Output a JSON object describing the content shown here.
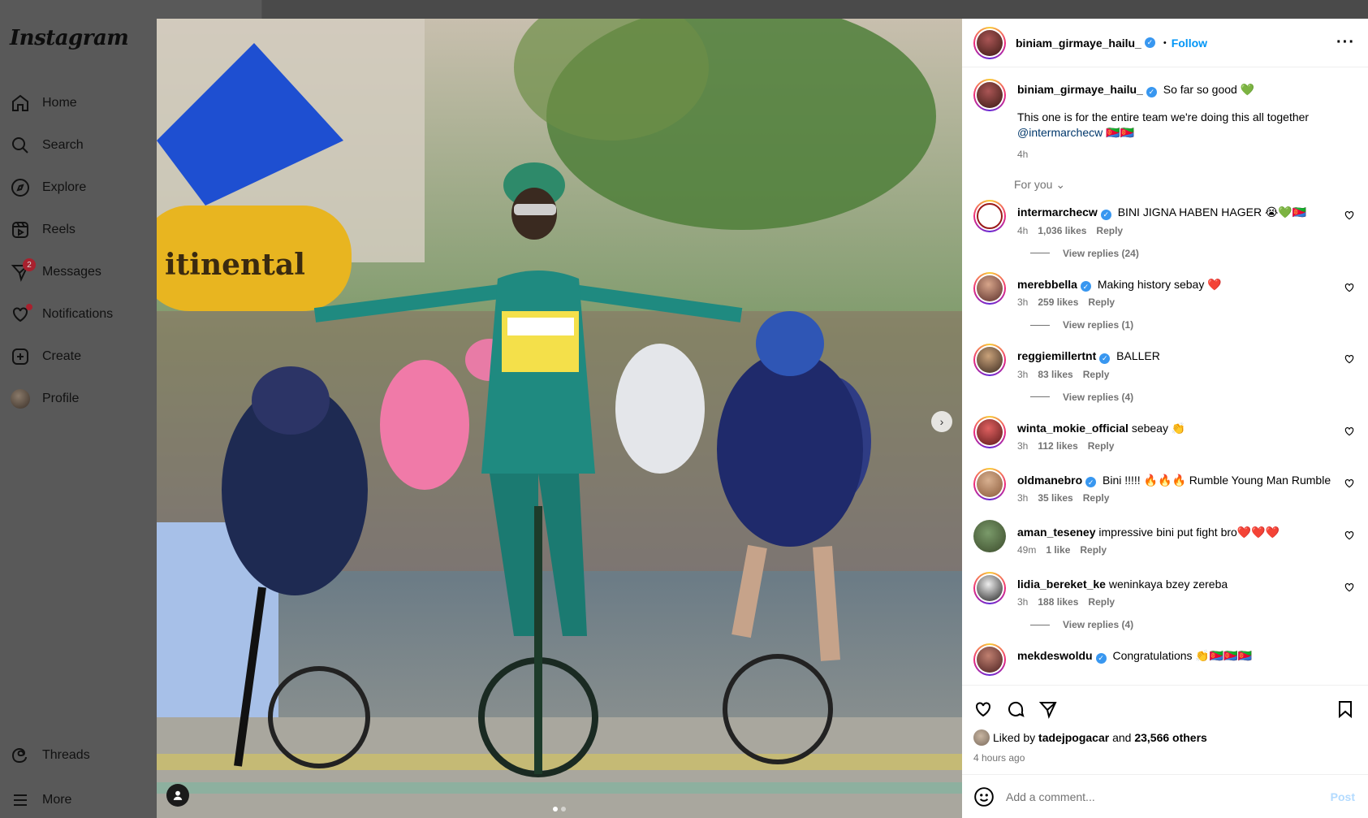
{
  "sidebar": {
    "logo": "Instagram",
    "items": [
      {
        "label": "Home"
      },
      {
        "label": "Search"
      },
      {
        "label": "Explore"
      },
      {
        "label": "Reels"
      },
      {
        "label": "Messages",
        "badge": "2"
      },
      {
        "label": "Notifications"
      },
      {
        "label": "Create"
      },
      {
        "label": "Profile"
      }
    ],
    "bottom": [
      {
        "label": "Threads"
      },
      {
        "label": "More"
      }
    ]
  },
  "post": {
    "author": "biniam_girmaye_hailu_",
    "follow_label": "Follow",
    "separator": "•",
    "caption": {
      "author": "biniam_girmaye_hailu_",
      "line1": "So far so good 💚",
      "line2": "This one is for the entire team we're doing this all together",
      "mention": "@intermarchecw",
      "mention_suffix": " 🇪🇷🇪🇷",
      "time": "4h"
    },
    "for_you": "For you",
    "comments": [
      {
        "user": "intermarchecw",
        "verified": true,
        "text": "BINI JIGNA HABEN HAGER 😭💚🇪🇷",
        "time": "4h",
        "likes": "1,036 likes",
        "reply": "Reply",
        "view_replies": "View replies (24)"
      },
      {
        "user": "merebbella",
        "verified": true,
        "text": "Making history sebay ❤️",
        "time": "3h",
        "likes": "259 likes",
        "reply": "Reply",
        "view_replies": "View replies (1)"
      },
      {
        "user": "reggiemillertnt",
        "verified": true,
        "text": "BALLER",
        "time": "3h",
        "likes": "83 likes",
        "reply": "Reply",
        "view_replies": "View replies (4)"
      },
      {
        "user": "winta_mokie_official",
        "verified": false,
        "text": "sebeay 👏",
        "time": "3h",
        "likes": "112 likes",
        "reply": "Reply",
        "view_replies": ""
      },
      {
        "user": "oldmanebro",
        "verified": true,
        "text": "Bini !!!!! 🔥🔥🔥 Rumble Young Man Rumble",
        "time": "3h",
        "likes": "35 likes",
        "reply": "Reply",
        "view_replies": ""
      },
      {
        "user": "aman_teseney",
        "verified": false,
        "text": "impressive bini put fight bro❤️❤️❤️",
        "time": "49m",
        "likes": "1 like",
        "reply": "Reply",
        "view_replies": ""
      },
      {
        "user": "lidia_bereket_ke",
        "verified": false,
        "text": "weninkaya bzey zereba",
        "time": "3h",
        "likes": "188 likes",
        "reply": "Reply",
        "view_replies": "View replies (4)"
      },
      {
        "user": "mekdeswoldu",
        "verified": true,
        "text": "Congratulations 👏🇪🇷🇪🇷🇪🇷",
        "time": "",
        "likes": "",
        "reply": "",
        "view_replies": ""
      }
    ],
    "liked_by_prefix": "Liked by",
    "liked_by_user": "tadejpogacar",
    "liked_by_and": "and",
    "liked_by_others": "23,566 others",
    "posted_ago": "4 hours ago",
    "add_comment_placeholder": "Add a comment...",
    "post_label": "Post"
  },
  "colors": {
    "link_blue": "#0095f6",
    "verified_blue": "#3897f0",
    "jersey_green": "#1f8a80",
    "flag_blue": "#1e4fd1"
  }
}
